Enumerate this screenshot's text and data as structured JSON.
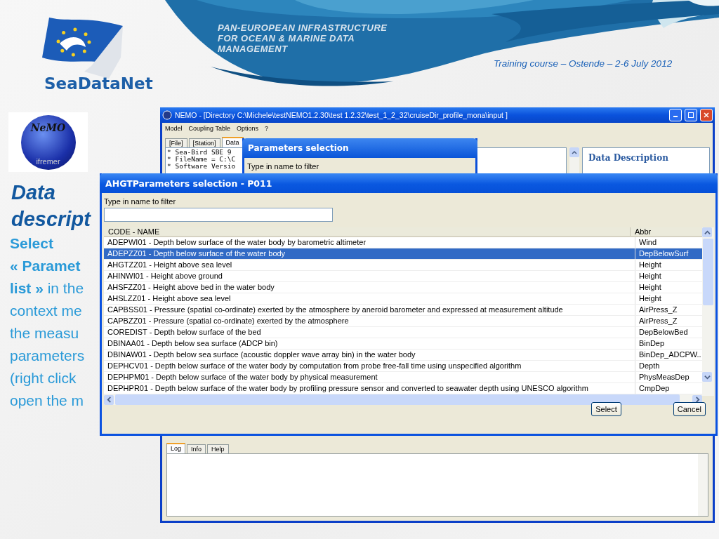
{
  "header": {
    "logo_text": "SeaDataNet",
    "tagline": [
      "PAN-EUROPEAN INFRASTRUCTURE",
      "FOR OCEAN & MARINE DATA",
      "MANAGEMENT"
    ],
    "event": "Training course – Ostende – 2-6 July 2012"
  },
  "side": {
    "nemo_logo": {
      "title": "NeMO",
      "subtitle": "ifremer"
    },
    "heading": [
      "Data",
      "descript"
    ],
    "lines": [
      {
        "text": "Select",
        "kind": "strong"
      },
      {
        "text": "« Paramet",
        "kind": "strong"
      },
      {
        "text": "**list »** in the",
        "kind": "plain"
      },
      {
        "text": "context me",
        "kind": "plain"
      },
      {
        "text": "the measu",
        "kind": "plain"
      },
      {
        "text": "parameters",
        "kind": "plain"
      },
      {
        "text": "(right click",
        "kind": "plain"
      },
      {
        "text": "open the m",
        "kind": "plain"
      }
    ]
  },
  "main_window": {
    "title": "NEMO - [Directory C:\\Michele\\testNEMO1.2.30\\test 1.2.32\\test_1_2_32\\cruiseDir_profile_mona\\input ]",
    "menu": [
      "Model",
      "Coupling Table",
      "Options",
      "?"
    ],
    "tabs": [
      {
        "label": "[File]",
        "selected": false
      },
      {
        "label": "[Station]",
        "selected": false
      },
      {
        "label": "Data",
        "selected": true
      }
    ],
    "file_lines": [
      "* Sea-Bird SBE 9",
      "* FileName = C:\\C",
      "* Software Versio"
    ],
    "description_title": "Data Description",
    "log_tabs": [
      {
        "label": "Log",
        "selected": true
      },
      {
        "label": "Info",
        "selected": false
      },
      {
        "label": "Help",
        "selected": false
      }
    ]
  },
  "back_dialog": {
    "title": "Parameters selection",
    "filter_label": "Type in name to filter"
  },
  "dialog": {
    "title": "AHGTParameters selection - P011",
    "filter_label": "Type in name to filter",
    "columns": [
      "CODE - NAME",
      "Abbr"
    ],
    "rows": [
      {
        "name": "ADEPWI01 - Depth below surface of the water body by barometric altimeter",
        "abbr": "Wind",
        "selected": false
      },
      {
        "name": "ADEPZZ01 - Depth below surface of the water body",
        "abbr": "DepBelowSurf",
        "selected": true
      },
      {
        "name": "AHGTZZ01 - Height above sea level",
        "abbr": "Height",
        "selected": false
      },
      {
        "name": "AHINWI01 - Height above ground",
        "abbr": "Height",
        "selected": false
      },
      {
        "name": "AHSFZZ01 - Height above bed in the water body",
        "abbr": "Height",
        "selected": false
      },
      {
        "name": "AHSLZZ01 - Height above sea level",
        "abbr": "Height",
        "selected": false
      },
      {
        "name": "CAPBSS01 - Pressure (spatial co-ordinate) exerted by the atmosphere by aneroid barometer and expressed at measurement altitude",
        "abbr": "AirPress_Z",
        "selected": false
      },
      {
        "name": "CAPBZZ01 - Pressure (spatial co-ordinate) exerted by the atmosphere",
        "abbr": "AirPress_Z",
        "selected": false
      },
      {
        "name": "COREDIST - Depth below surface of the bed",
        "abbr": "DepBelowBed",
        "selected": false
      },
      {
        "name": "DBINAA01 - Depth below sea surface (ADCP bin)",
        "abbr": "BinDep",
        "selected": false
      },
      {
        "name": "DBINAW01 - Depth below sea surface (acoustic doppler wave array bin) in the water body",
        "abbr": "BinDep_ADCPW..",
        "selected": false
      },
      {
        "name": "DEPHCV01 - Depth below surface of the water body by computation from probe free-fall time using unspecified algorithm",
        "abbr": "Depth",
        "selected": false
      },
      {
        "name": "DEPHPM01 - Depth below surface of the water body by physical measurement",
        "abbr": "PhysMeasDep",
        "selected": false
      },
      {
        "name": "DEPHPR01 - Depth below surface of the water body by profiling pressure sensor and converted to seawater depth using UNESCO algorithm",
        "abbr": "CmpDep",
        "selected": false
      }
    ],
    "buttons": [
      "Select",
      "Cancel"
    ]
  }
}
